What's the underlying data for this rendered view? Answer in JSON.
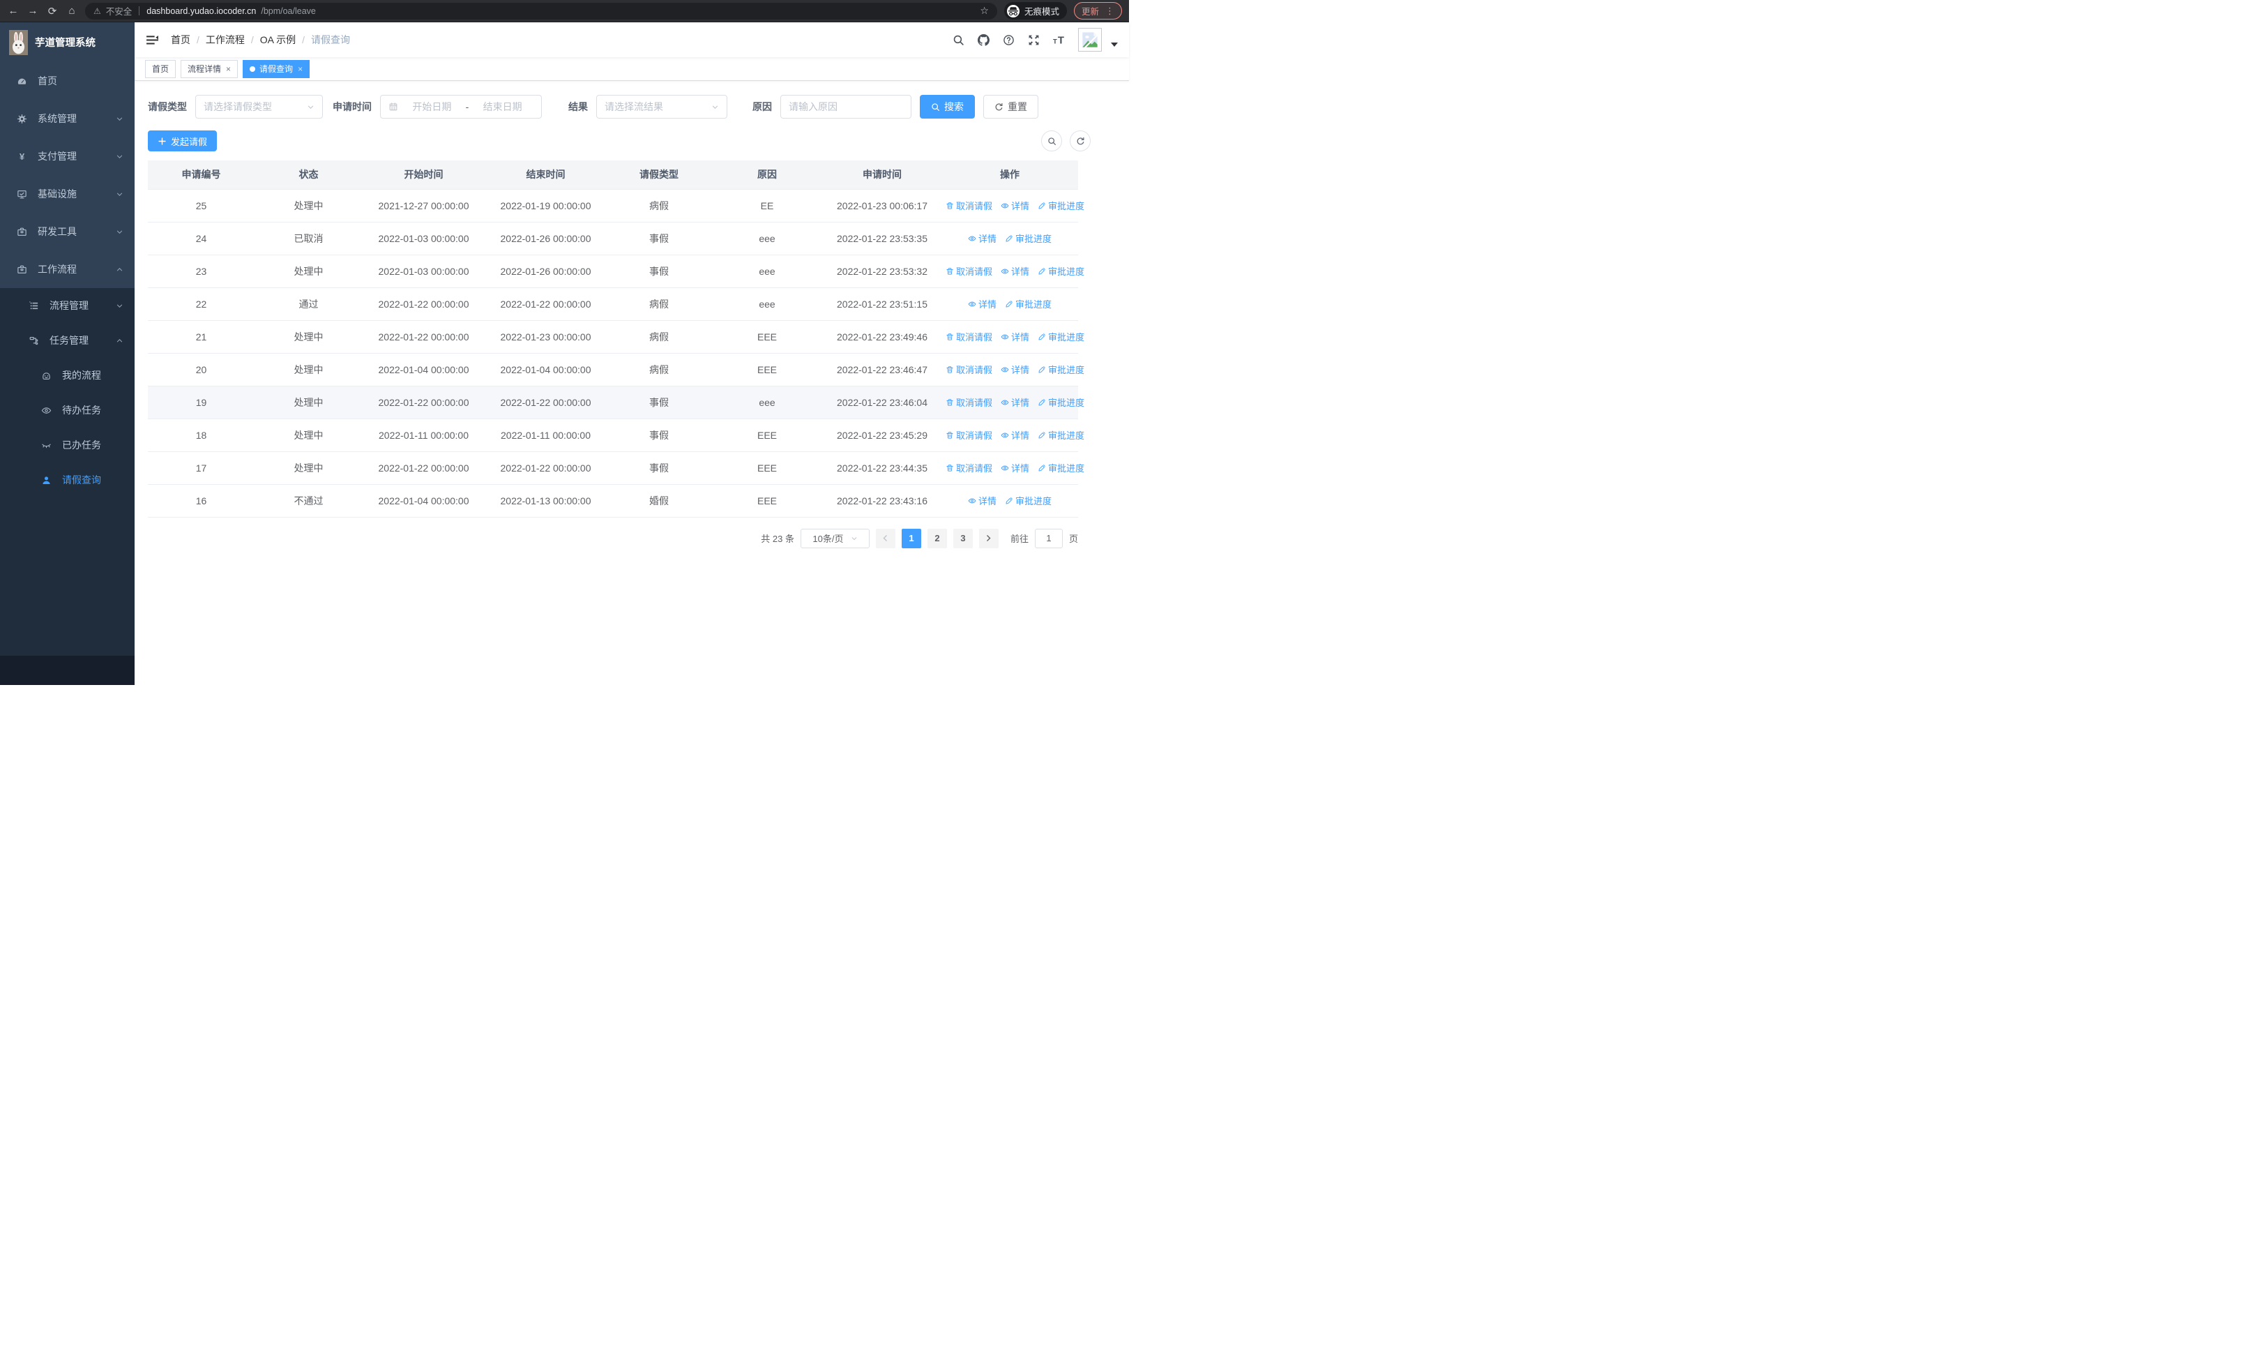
{
  "browser": {
    "security_label": "不安全",
    "url_host": "dashboard.yudao.iocoder.cn",
    "url_path": "/bpm/oa/leave",
    "incognito_label": "无痕模式",
    "update_label": "更新"
  },
  "sidebar": {
    "app_title": "芋道管理系统",
    "items": [
      {
        "label": "首页",
        "icon": "dashboard-icon"
      },
      {
        "label": "系统管理",
        "icon": "gear-icon",
        "chevron": "down"
      },
      {
        "label": "支付管理",
        "icon": "yen-icon",
        "chevron": "down"
      },
      {
        "label": "基础设施",
        "icon": "monitor-icon",
        "chevron": "down"
      },
      {
        "label": "研发工具",
        "icon": "toolbox-icon",
        "chevron": "down"
      },
      {
        "label": "工作流程",
        "icon": "briefcase-icon",
        "chevron": "up"
      }
    ],
    "submenu": [
      {
        "label": "流程管理",
        "icon": "tree-list-icon",
        "chevron": "down",
        "level": 1
      },
      {
        "label": "任务管理",
        "icon": "org-icon",
        "chevron": "up",
        "level": 1
      },
      {
        "label": "我的流程",
        "icon": "face-icon",
        "level": 2
      },
      {
        "label": "待办任务",
        "icon": "eye-open-icon",
        "level": 2
      },
      {
        "label": "已办任务",
        "icon": "eye-closed-icon",
        "level": 2
      },
      {
        "label": "请假查询",
        "icon": "user-icon",
        "level": 2,
        "active": true
      }
    ]
  },
  "navbar": {
    "breadcrumb": [
      "首页",
      "工作流程",
      "OA 示例",
      "请假查询"
    ],
    "right_icons": [
      "search-icon",
      "github-icon",
      "help-icon",
      "fullscreen-icon",
      "font-size-icon"
    ]
  },
  "tabs": [
    {
      "label": "首页",
      "closable": false,
      "active": false
    },
    {
      "label": "流程详情",
      "closable": true,
      "active": false
    },
    {
      "label": "请假查询",
      "closable": true,
      "active": true
    }
  ],
  "filters": {
    "leave_type": {
      "label": "请假类型",
      "placeholder": "请选择请假类型"
    },
    "apply_time": {
      "label": "申请时间",
      "start_placeholder": "开始日期",
      "separator": "-",
      "end_placeholder": "结束日期"
    },
    "result": {
      "label": "结果",
      "placeholder": "请选择流结果"
    },
    "reason": {
      "label": "原因",
      "placeholder": "请输入原因"
    },
    "search_label": "搜索",
    "reset_label": "重置"
  },
  "toolbar": {
    "create_label": "发起请假"
  },
  "table": {
    "columns": [
      "申请编号",
      "状态",
      "开始时间",
      "结束时间",
      "请假类型",
      "原因",
      "申请时间",
      "操作"
    ],
    "action_labels": {
      "cancel": "取消请假",
      "detail": "详情",
      "progress": "审批进度"
    },
    "rows": [
      {
        "id": "25",
        "status": "处理中",
        "start": "2021-12-27 00:00:00",
        "end": "2022-01-19 00:00:00",
        "type": "病假",
        "reason": "EE",
        "apply": "2022-01-23 00:06:17",
        "actions": [
          "cancel",
          "detail",
          "progress"
        ],
        "highlight": false
      },
      {
        "id": "24",
        "status": "已取消",
        "start": "2022-01-03 00:00:00",
        "end": "2022-01-26 00:00:00",
        "type": "事假",
        "reason": "eee",
        "apply": "2022-01-22 23:53:35",
        "actions": [
          "detail",
          "progress"
        ],
        "highlight": false
      },
      {
        "id": "23",
        "status": "处理中",
        "start": "2022-01-03 00:00:00",
        "end": "2022-01-26 00:00:00",
        "type": "事假",
        "reason": "eee",
        "apply": "2022-01-22 23:53:32",
        "actions": [
          "cancel",
          "detail",
          "progress"
        ],
        "highlight": false
      },
      {
        "id": "22",
        "status": "通过",
        "start": "2022-01-22 00:00:00",
        "end": "2022-01-22 00:00:00",
        "type": "病假",
        "reason": "eee",
        "apply": "2022-01-22 23:51:15",
        "actions": [
          "detail",
          "progress"
        ],
        "highlight": false
      },
      {
        "id": "21",
        "status": "处理中",
        "start": "2022-01-22 00:00:00",
        "end": "2022-01-23 00:00:00",
        "type": "病假",
        "reason": "EEE",
        "apply": "2022-01-22 23:49:46",
        "actions": [
          "cancel",
          "detail",
          "progress"
        ],
        "highlight": false
      },
      {
        "id": "20",
        "status": "处理中",
        "start": "2022-01-04 00:00:00",
        "end": "2022-01-04 00:00:00",
        "type": "病假",
        "reason": "EEE",
        "apply": "2022-01-22 23:46:47",
        "actions": [
          "cancel",
          "detail",
          "progress"
        ],
        "highlight": false
      },
      {
        "id": "19",
        "status": "处理中",
        "start": "2022-01-22 00:00:00",
        "end": "2022-01-22 00:00:00",
        "type": "事假",
        "reason": "eee",
        "apply": "2022-01-22 23:46:04",
        "actions": [
          "cancel",
          "detail",
          "progress"
        ],
        "highlight": true
      },
      {
        "id": "18",
        "status": "处理中",
        "start": "2022-01-11 00:00:00",
        "end": "2022-01-11 00:00:00",
        "type": "事假",
        "reason": "EEE",
        "apply": "2022-01-22 23:45:29",
        "actions": [
          "cancel",
          "detail",
          "progress"
        ],
        "highlight": false
      },
      {
        "id": "17",
        "status": "处理中",
        "start": "2022-01-22 00:00:00",
        "end": "2022-01-22 00:00:00",
        "type": "事假",
        "reason": "EEE",
        "apply": "2022-01-22 23:44:35",
        "actions": [
          "cancel",
          "detail",
          "progress"
        ],
        "highlight": false
      },
      {
        "id": "16",
        "status": "不通过",
        "start": "2022-01-04 00:00:00",
        "end": "2022-01-13 00:00:00",
        "type": "婚假",
        "reason": "EEE",
        "apply": "2022-01-22 23:43:16",
        "actions": [
          "detail",
          "progress"
        ],
        "highlight": false
      }
    ]
  },
  "pagination": {
    "total_label": "共 23 条",
    "page_size": "10条/页",
    "pages": [
      "1",
      "2",
      "3"
    ],
    "active_page": "1",
    "goto_label": "前往",
    "goto_value": "1",
    "page_label": "页"
  },
  "colors": {
    "primary": "#409eff",
    "sidebar_bg": "#304156",
    "submenu_bg": "#1f2d3d"
  }
}
